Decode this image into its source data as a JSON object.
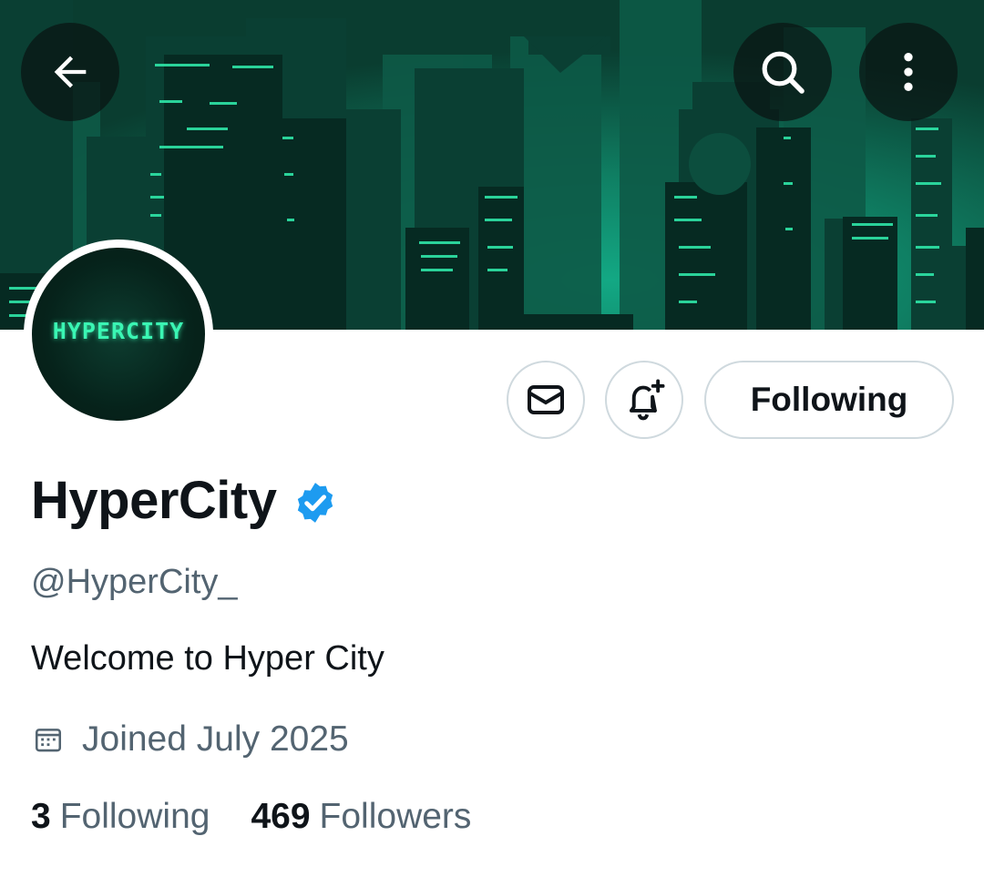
{
  "banner": {
    "description_icon": "city-skyline-banner",
    "accent_color": "#2ee6a8",
    "sky_color": "#0f8a6c"
  },
  "nav": {
    "back_icon": "arrow-left-icon",
    "search_icon": "search-icon",
    "more_icon": "more-vertical-icon"
  },
  "profile": {
    "avatar_text": "HYPERCITY",
    "display_name": "HyperCity",
    "verified_color": "#1d9bf0",
    "handle": "@HyperCity_",
    "bio": "Welcome to Hyper City",
    "joined": "Joined July 2025"
  },
  "actions": {
    "message_icon": "mail-icon",
    "notify_icon": "bell-plus-icon",
    "follow_label": "Following"
  },
  "stats": {
    "following_count": "3",
    "following_label": "Following",
    "followers_count": "469",
    "followers_label": "Followers"
  }
}
